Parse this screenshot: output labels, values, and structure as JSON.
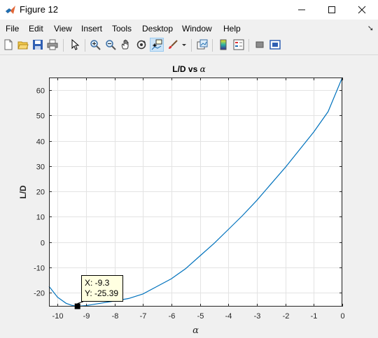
{
  "window": {
    "title": "Figure 12"
  },
  "menu": [
    "File",
    "Edit",
    "View",
    "Insert",
    "Tools",
    "Desktop",
    "Window",
    "Help"
  ],
  "toolbar": {
    "icons": [
      "new-figure-icon",
      "open-file-icon",
      "save-icon",
      "print-icon",
      "edit-plot-arrow-icon",
      "zoom-in-icon",
      "zoom-out-icon",
      "pan-hand-icon",
      "rotate-3d-icon",
      "data-cursor-icon",
      "brush-icon",
      "dropdown-arrow-icon",
      "link-plot-icon",
      "insert-colorbar-icon",
      "insert-legend-icon",
      "hide-plot-tools-icon",
      "show-plot-tools-icon"
    ]
  },
  "datatip": {
    "x_label": "X: -9.3",
    "y_label": "Y: -25.39"
  },
  "chart_data": {
    "type": "line",
    "title": "L/D vs α",
    "title_prefix": "L/D vs",
    "title_symbol": "α",
    "xlabel": "α",
    "ylabel": "L/D",
    "xlim": [
      -10.3,
      0
    ],
    "ylim": [
      -25.5,
      65
    ],
    "xticks": [
      -10,
      -9,
      -8,
      -7,
      -6,
      -5,
      -4,
      -3,
      -2,
      -1,
      0
    ],
    "yticks": [
      -20,
      -10,
      0,
      10,
      20,
      30,
      40,
      50,
      60
    ],
    "grid": true,
    "series": [
      {
        "color": "#0072bd",
        "x": [
          -10.3,
          -10.0,
          -9.7,
          -9.5,
          -9.3,
          -9.0,
          -8.5,
          -8.0,
          -7.5,
          -7.0,
          -6.5,
          -6.0,
          -5.5,
          -5.0,
          -4.5,
          -4.0,
          -3.5,
          -3.0,
          -2.5,
          -2.0,
          -1.5,
          -1.0,
          -0.5,
          0.0
        ],
        "y": [
          -17.5,
          -21.8,
          -24.2,
          -25.0,
          -25.39,
          -25.1,
          -24.2,
          -23.3,
          -22.3,
          -20.5,
          -17.5,
          -14.5,
          -10.5,
          -5.5,
          -0.5,
          5.0,
          10.5,
          16.5,
          23.0,
          29.5,
          36.5,
          43.5,
          51.5,
          65.0
        ]
      }
    ],
    "highlight": {
      "x": -9.3,
      "y": -25.39
    }
  }
}
